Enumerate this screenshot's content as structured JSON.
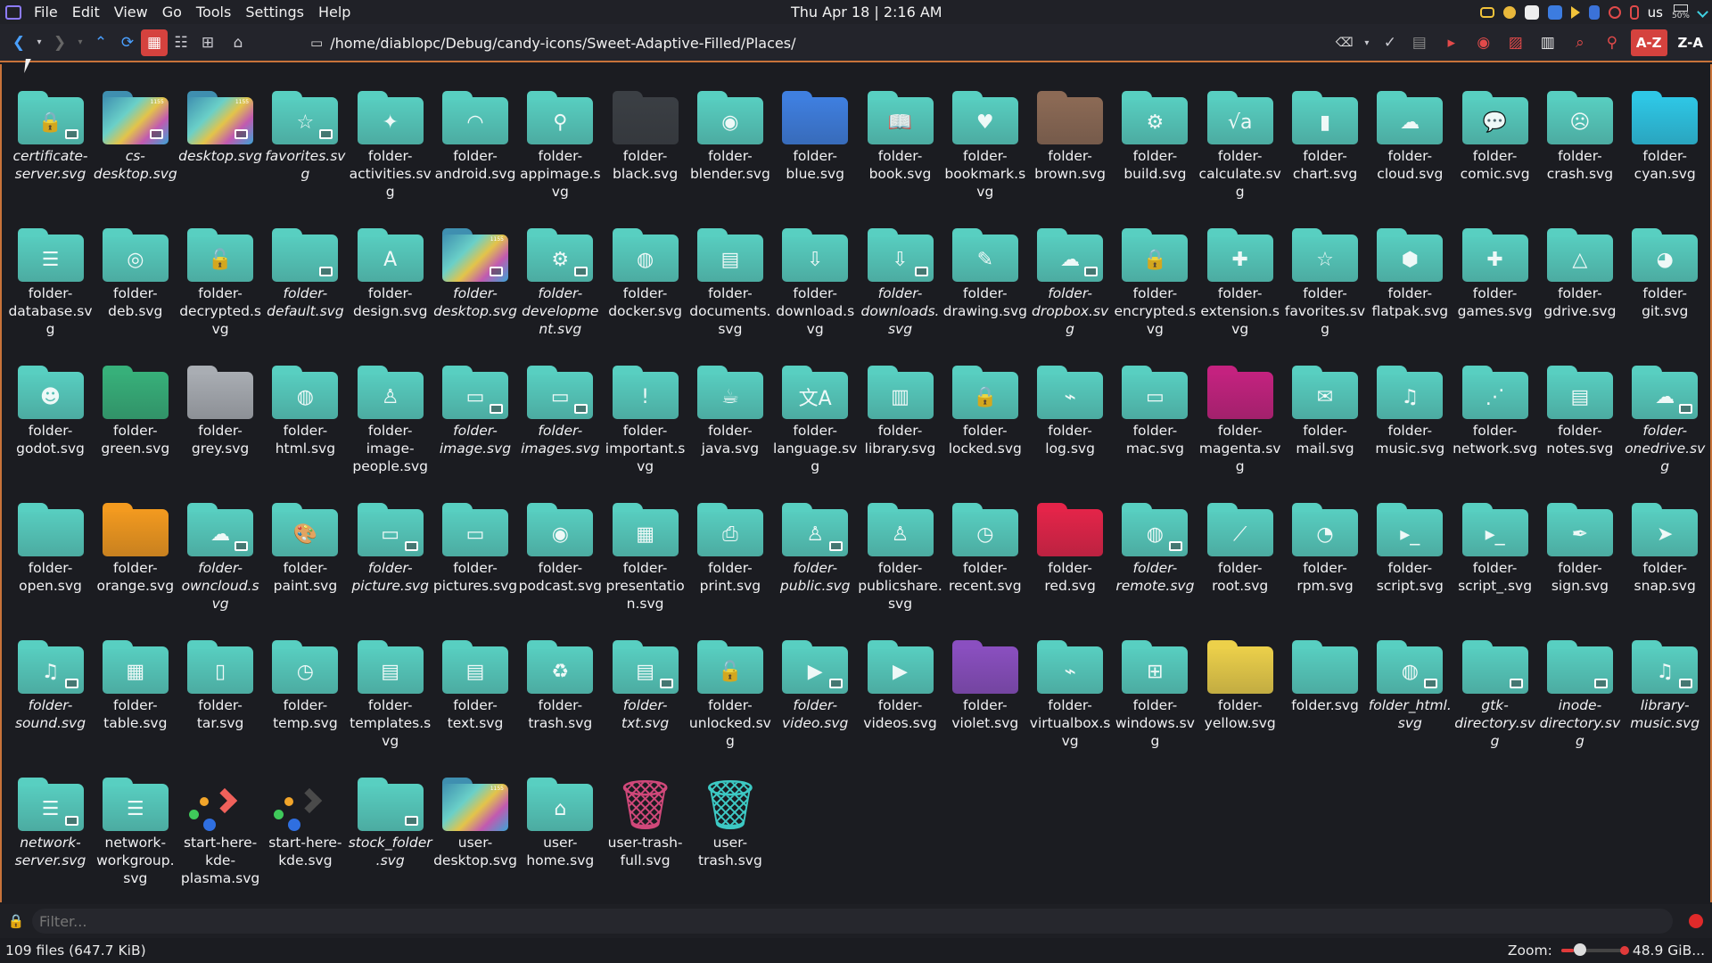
{
  "menubar": [
    "File",
    "Edit",
    "View",
    "Go",
    "Tools",
    "Settings",
    "Help"
  ],
  "clock": "Thu Apr 18 |  2:16 AM",
  "tray": {
    "lang": "us",
    "battery": "50%"
  },
  "toolbar": {
    "path": "/home/diablopc/Debug/candy-icons/Sweet-Adaptive-Filled/Places/",
    "sort_az": "A-Z",
    "sort_za": "Z-A"
  },
  "filter": {
    "placeholder": "Filter..."
  },
  "status": {
    "files": "109 files (647.7 KiB)",
    "zoom_label": "Zoom:",
    "free": "48.9 GiB..."
  },
  "colors": {
    "accent": "#c8733a",
    "teal": "#58cfc1",
    "active": "#d5423e"
  },
  "items": [
    {
      "label": "certificate-server.svg",
      "italic": true,
      "kind": "folder",
      "color": "#58cfc1",
      "glyph": "🔒",
      "link": true
    },
    {
      "label": "cs-desktop.svg",
      "italic": true,
      "kind": "wall",
      "link": true
    },
    {
      "label": "desktop.svg",
      "italic": true,
      "kind": "wall",
      "link": true
    },
    {
      "label": "favorites.svg",
      "italic": true,
      "kind": "folder",
      "color": "#58cfc1",
      "glyph": "☆",
      "link": true
    },
    {
      "label": "folder-activities.svg",
      "italic": false,
      "kind": "folder",
      "color": "#58cfc1",
      "glyph": "✦"
    },
    {
      "label": "folder-android.svg",
      "italic": false,
      "kind": "folder",
      "color": "#58cfc1",
      "glyph": "◠"
    },
    {
      "label": "folder-appimage.svg",
      "italic": false,
      "kind": "folder",
      "color": "#58cfc1",
      "glyph": "⚲"
    },
    {
      "label": "folder-black.svg",
      "italic": false,
      "kind": "folder",
      "color": "#3b3f44",
      "glyph": ""
    },
    {
      "label": "folder-blender.svg",
      "italic": false,
      "kind": "folder",
      "color": "#58cfc1",
      "glyph": "◉"
    },
    {
      "label": "folder-blue.svg",
      "italic": false,
      "kind": "folder",
      "color": "#3f7fe0",
      "glyph": ""
    },
    {
      "label": "folder-book.svg",
      "italic": false,
      "kind": "folder",
      "color": "#58cfc1",
      "glyph": "📖"
    },
    {
      "label": "folder-bookmark.svg",
      "italic": false,
      "kind": "folder",
      "color": "#58cfc1",
      "glyph": "♥"
    },
    {
      "label": "folder-brown.svg",
      "italic": false,
      "kind": "folder",
      "color": "#8c6a55",
      "glyph": ""
    },
    {
      "label": "folder-build.svg",
      "italic": false,
      "kind": "folder",
      "color": "#58cfc1",
      "glyph": "⚙"
    },
    {
      "label": "folder-calculate.svg",
      "italic": false,
      "kind": "folder",
      "color": "#58cfc1",
      "glyph": "√a"
    },
    {
      "label": "folder-chart.svg",
      "italic": false,
      "kind": "folder",
      "color": "#58cfc1",
      "glyph": "▮"
    },
    {
      "label": "folder-cloud.svg",
      "italic": false,
      "kind": "folder",
      "color": "#58cfc1",
      "glyph": "☁"
    },
    {
      "label": "folder-comic.svg",
      "italic": false,
      "kind": "folder",
      "color": "#58cfc1",
      "glyph": "💬"
    },
    {
      "label": "folder-crash.svg",
      "italic": false,
      "kind": "folder",
      "color": "#58cfc1",
      "glyph": "☹"
    },
    {
      "label": "folder-cyan.svg",
      "italic": false,
      "kind": "folder",
      "color": "#2ec7e6",
      "glyph": ""
    },
    {
      "label": "folder-database.svg",
      "italic": false,
      "kind": "folder",
      "color": "#58cfc1",
      "glyph": "☰"
    },
    {
      "label": "folder-deb.svg",
      "italic": false,
      "kind": "folder",
      "color": "#58cfc1",
      "glyph": "◎"
    },
    {
      "label": "folder-decrypted.svg",
      "italic": false,
      "kind": "folder",
      "color": "#58cfc1",
      "glyph": "🔓"
    },
    {
      "label": "folder-default.svg",
      "italic": true,
      "kind": "folder",
      "color": "#58cfc1",
      "glyph": "",
      "link": true
    },
    {
      "label": "folder-design.svg",
      "italic": false,
      "kind": "folder",
      "color": "#58cfc1",
      "glyph": "A"
    },
    {
      "label": "folder-desktop.svg",
      "italic": true,
      "kind": "wall",
      "link": true
    },
    {
      "label": "folder-development.svg",
      "italic": true,
      "kind": "folder",
      "color": "#58cfc1",
      "glyph": "⚙",
      "link": true
    },
    {
      "label": "folder-docker.svg",
      "italic": false,
      "kind": "folder",
      "color": "#58cfc1",
      "glyph": "◍"
    },
    {
      "label": "folder-documents.svg",
      "italic": false,
      "kind": "folder",
      "color": "#58cfc1",
      "glyph": "▤"
    },
    {
      "label": "folder-download.svg",
      "italic": false,
      "kind": "folder",
      "color": "#58cfc1",
      "glyph": "⇩"
    },
    {
      "label": "folder-downloads.svg",
      "italic": true,
      "kind": "folder",
      "color": "#58cfc1",
      "glyph": "⇩",
      "link": true
    },
    {
      "label": "folder-drawing.svg",
      "italic": false,
      "kind": "folder",
      "color": "#58cfc1",
      "glyph": "✎"
    },
    {
      "label": "folder-dropbox.svg",
      "italic": true,
      "kind": "folder",
      "color": "#58cfc1",
      "glyph": "☁",
      "link": true
    },
    {
      "label": "folder-encrypted.svg",
      "italic": false,
      "kind": "folder",
      "color": "#58cfc1",
      "glyph": "🔒"
    },
    {
      "label": "folder-extension.svg",
      "italic": false,
      "kind": "folder",
      "color": "#58cfc1",
      "glyph": "✚"
    },
    {
      "label": "folder-favorites.svg",
      "italic": false,
      "kind": "folder",
      "color": "#58cfc1",
      "glyph": "☆"
    },
    {
      "label": "folder-flatpak.svg",
      "italic": false,
      "kind": "folder",
      "color": "#58cfc1",
      "glyph": "⬢"
    },
    {
      "label": "folder-games.svg",
      "italic": false,
      "kind": "folder",
      "color": "#58cfc1",
      "glyph": "✚"
    },
    {
      "label": "folder-gdrive.svg",
      "italic": false,
      "kind": "folder",
      "color": "#58cfc1",
      "glyph": "△"
    },
    {
      "label": "folder-git.svg",
      "italic": false,
      "kind": "folder",
      "color": "#58cfc1",
      "glyph": "◕"
    },
    {
      "label": "folder-godot.svg",
      "italic": false,
      "kind": "folder",
      "color": "#58cfc1",
      "glyph": "☻"
    },
    {
      "label": "folder-green.svg",
      "italic": false,
      "kind": "folder",
      "color": "#37b07a",
      "glyph": ""
    },
    {
      "label": "folder-grey.svg",
      "italic": false,
      "kind": "folder",
      "color": "#a9adb3",
      "glyph": ""
    },
    {
      "label": "folder-html.svg",
      "italic": false,
      "kind": "folder",
      "color": "#58cfc1",
      "glyph": "◍"
    },
    {
      "label": "folder-image-people.svg",
      "italic": false,
      "kind": "folder",
      "color": "#58cfc1",
      "glyph": "♙"
    },
    {
      "label": "folder-image.svg",
      "italic": true,
      "kind": "folder",
      "color": "#58cfc1",
      "glyph": "▭",
      "link": true
    },
    {
      "label": "folder-images.svg",
      "italic": true,
      "kind": "folder",
      "color": "#58cfc1",
      "glyph": "▭",
      "link": true
    },
    {
      "label": "folder-important.svg",
      "italic": false,
      "kind": "folder",
      "color": "#58cfc1",
      "glyph": "!"
    },
    {
      "label": "folder-java.svg",
      "italic": false,
      "kind": "folder",
      "color": "#58cfc1",
      "glyph": "☕"
    },
    {
      "label": "folder-language.svg",
      "italic": false,
      "kind": "folder",
      "color": "#58cfc1",
      "glyph": "文A"
    },
    {
      "label": "folder-library.svg",
      "italic": false,
      "kind": "folder",
      "color": "#58cfc1",
      "glyph": "▥"
    },
    {
      "label": "folder-locked.svg",
      "italic": false,
      "kind": "folder",
      "color": "#58cfc1",
      "glyph": "🔒"
    },
    {
      "label": "folder-log.svg",
      "italic": false,
      "kind": "folder",
      "color": "#58cfc1",
      "glyph": "⌁"
    },
    {
      "label": "folder-mac.svg",
      "italic": false,
      "kind": "folder",
      "color": "#58cfc1",
      "glyph": "▭"
    },
    {
      "label": "folder-magenta.svg",
      "italic": false,
      "kind": "folder",
      "color": "#c4227f",
      "glyph": ""
    },
    {
      "label": "folder-mail.svg",
      "italic": false,
      "kind": "folder",
      "color": "#58cfc1",
      "glyph": "✉"
    },
    {
      "label": "folder-music.svg",
      "italic": false,
      "kind": "folder",
      "color": "#58cfc1",
      "glyph": "♫"
    },
    {
      "label": "folder-network.svg",
      "italic": false,
      "kind": "folder",
      "color": "#58cfc1",
      "glyph": "⋰"
    },
    {
      "label": "folder-notes.svg",
      "italic": false,
      "kind": "folder",
      "color": "#58cfc1",
      "glyph": "▤"
    },
    {
      "label": "folder-onedrive.svg",
      "italic": true,
      "kind": "folder",
      "color": "#58cfc1",
      "glyph": "☁",
      "link": true
    },
    {
      "label": "folder-open.svg",
      "italic": false,
      "kind": "folder",
      "color": "#58cfc1",
      "glyph": ""
    },
    {
      "label": "folder-orange.svg",
      "italic": false,
      "kind": "folder",
      "color": "#f39a1f",
      "glyph": ""
    },
    {
      "label": "folder-owncloud.svg",
      "italic": true,
      "kind": "folder",
      "color": "#58cfc1",
      "glyph": "☁",
      "link": true
    },
    {
      "label": "folder-paint.svg",
      "italic": false,
      "kind": "folder",
      "color": "#58cfc1",
      "glyph": "🎨"
    },
    {
      "label": "folder-picture.svg",
      "italic": true,
      "kind": "folder",
      "color": "#58cfc1",
      "glyph": "▭",
      "link": true
    },
    {
      "label": "folder-pictures.svg",
      "italic": false,
      "kind": "folder",
      "color": "#58cfc1",
      "glyph": "▭"
    },
    {
      "label": "folder-podcast.svg",
      "italic": false,
      "kind": "folder",
      "color": "#58cfc1",
      "glyph": "◉"
    },
    {
      "label": "folder-presentation.svg",
      "italic": false,
      "kind": "folder",
      "color": "#58cfc1",
      "glyph": "▦"
    },
    {
      "label": "folder-print.svg",
      "italic": false,
      "kind": "folder",
      "color": "#58cfc1",
      "glyph": "⎙"
    },
    {
      "label": "folder-public.svg",
      "italic": true,
      "kind": "folder",
      "color": "#58cfc1",
      "glyph": "♙",
      "link": true
    },
    {
      "label": "folder-publicshare.svg",
      "italic": false,
      "kind": "folder",
      "color": "#58cfc1",
      "glyph": "♙"
    },
    {
      "label": "folder-recent.svg",
      "italic": false,
      "kind": "folder",
      "color": "#58cfc1",
      "glyph": "◷"
    },
    {
      "label": "folder-red.svg",
      "italic": false,
      "kind": "folder",
      "color": "#e42449",
      "glyph": ""
    },
    {
      "label": "folder-remote.svg",
      "italic": true,
      "kind": "folder",
      "color": "#58cfc1",
      "glyph": "◍",
      "link": true
    },
    {
      "label": "folder-root.svg",
      "italic": false,
      "kind": "folder",
      "color": "#58cfc1",
      "glyph": "⟋"
    },
    {
      "label": "folder-rpm.svg",
      "italic": false,
      "kind": "folder",
      "color": "#58cfc1",
      "glyph": "◔"
    },
    {
      "label": "folder-script.svg",
      "italic": false,
      "kind": "folder",
      "color": "#58cfc1",
      "glyph": "▸_"
    },
    {
      "label": "folder-script_.svg",
      "italic": false,
      "kind": "folder",
      "color": "#58cfc1",
      "glyph": "▸_"
    },
    {
      "label": "folder-sign.svg",
      "italic": false,
      "kind": "folder",
      "color": "#58cfc1",
      "glyph": "✒"
    },
    {
      "label": "folder-snap.svg",
      "italic": false,
      "kind": "folder",
      "color": "#58cfc1",
      "glyph": "➤"
    },
    {
      "label": "folder-sound.svg",
      "italic": true,
      "kind": "folder",
      "color": "#58cfc1",
      "glyph": "♫",
      "link": true
    },
    {
      "label": "folder-table.svg",
      "italic": false,
      "kind": "folder",
      "color": "#58cfc1",
      "glyph": "▦"
    },
    {
      "label": "folder-tar.svg",
      "italic": false,
      "kind": "folder",
      "color": "#58cfc1",
      "glyph": "▯"
    },
    {
      "label": "folder-temp.svg",
      "italic": false,
      "kind": "folder",
      "color": "#58cfc1",
      "glyph": "◷"
    },
    {
      "label": "folder-templates.svg",
      "italic": false,
      "kind": "folder",
      "color": "#58cfc1",
      "glyph": "▤"
    },
    {
      "label": "folder-text.svg",
      "italic": false,
      "kind": "folder",
      "color": "#58cfc1",
      "glyph": "▤"
    },
    {
      "label": "folder-trash.svg",
      "italic": false,
      "kind": "folder",
      "color": "#58cfc1",
      "glyph": "♻"
    },
    {
      "label": "folder-txt.svg",
      "italic": true,
      "kind": "folder",
      "color": "#58cfc1",
      "glyph": "▤",
      "link": true
    },
    {
      "label": "folder-unlocked.svg",
      "italic": false,
      "kind": "folder",
      "color": "#58cfc1",
      "glyph": "🔓"
    },
    {
      "label": "folder-video.svg",
      "italic": true,
      "kind": "folder",
      "color": "#58cfc1",
      "glyph": "▶",
      "link": true
    },
    {
      "label": "folder-videos.svg",
      "italic": false,
      "kind": "folder",
      "color": "#58cfc1",
      "glyph": "▶"
    },
    {
      "label": "folder-violet.svg",
      "italic": false,
      "kind": "folder",
      "color": "#8a4fc0",
      "glyph": ""
    },
    {
      "label": "folder-virtualbox.svg",
      "italic": false,
      "kind": "folder",
      "color": "#58cfc1",
      "glyph": "⌁"
    },
    {
      "label": "folder-windows.svg",
      "italic": false,
      "kind": "folder",
      "color": "#58cfc1",
      "glyph": "⊞"
    },
    {
      "label": "folder-yellow.svg",
      "italic": false,
      "kind": "folder",
      "color": "#ecd04a",
      "glyph": ""
    },
    {
      "label": "folder.svg",
      "italic": false,
      "kind": "folder",
      "color": "#58cfc1",
      "glyph": ""
    },
    {
      "label": "folder_html.svg",
      "italic": true,
      "kind": "folder",
      "color": "#58cfc1",
      "glyph": "◍",
      "link": true
    },
    {
      "label": "gtk-directory.svg",
      "italic": true,
      "kind": "folder",
      "color": "#58cfc1",
      "glyph": "",
      "link": true
    },
    {
      "label": "inode-directory.svg",
      "italic": true,
      "kind": "folder",
      "color": "#58cfc1",
      "glyph": "",
      "link": true
    },
    {
      "label": "library-music.svg",
      "italic": true,
      "kind": "folder",
      "color": "#58cfc1",
      "glyph": "♫",
      "link": true
    },
    {
      "label": "network-server.svg",
      "italic": true,
      "kind": "folder",
      "color": "#58cfc1",
      "glyph": "☰",
      "link": true
    },
    {
      "label": "network-workgroup.svg",
      "italic": false,
      "kind": "folder",
      "color": "#58cfc1",
      "glyph": "☰"
    },
    {
      "label": "start-here-kde-plasma.svg",
      "italic": false,
      "kind": "kde",
      "chev": "#f0615b"
    },
    {
      "label": "start-here-kde.svg",
      "italic": false,
      "kind": "kde",
      "chev": "#4a4a4a"
    },
    {
      "label": "stock_folder.svg",
      "italic": true,
      "kind": "folder",
      "color": "#58cfc1",
      "glyph": "",
      "link": true
    },
    {
      "label": "user-desktop.svg",
      "italic": false,
      "kind": "wall"
    },
    {
      "label": "user-home.svg",
      "italic": false,
      "kind": "folder",
      "color": "#58cfc1",
      "glyph": "⌂"
    },
    {
      "label": "user-trash-full.svg",
      "italic": false,
      "kind": "trash",
      "tcolor": "#d0487a"
    },
    {
      "label": "user-trash.svg",
      "italic": false,
      "kind": "trash",
      "tcolor": "#3dc9c4"
    }
  ]
}
